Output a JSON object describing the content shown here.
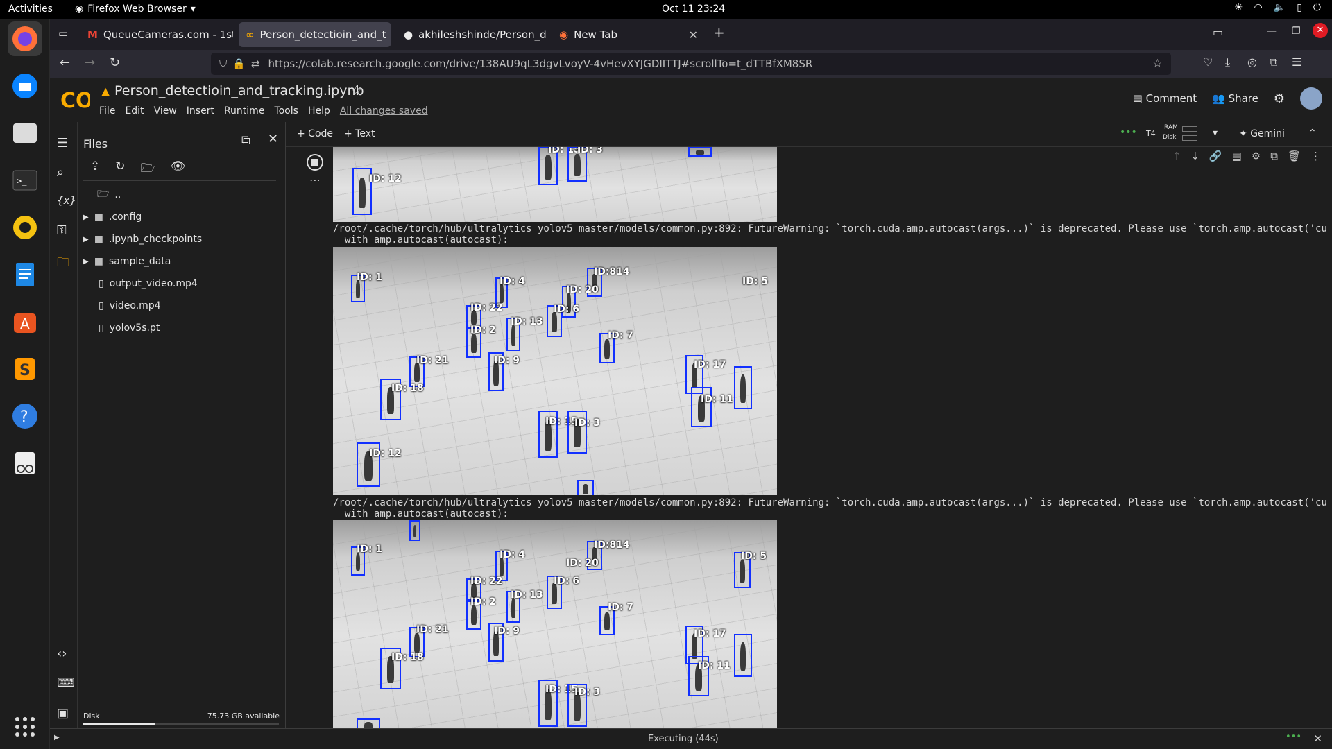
{
  "system": {
    "activities": "Activities",
    "app_name": "Firefox Web Browser",
    "clock": "Oct 11  23:24"
  },
  "dock": {
    "icons": [
      "firefox-icon",
      "thunderbird-icon",
      "files-icon",
      "terminal-icon",
      "rhythmbox-icon",
      "writer-icon",
      "app-center-icon",
      "sublime-icon",
      "help-icon",
      "reader-icon",
      "app-grid-icon"
    ]
  },
  "browser": {
    "tabs": [
      {
        "title": "QueueCameras.com - 1st"
      },
      {
        "title": "Person_detectioin_and_t"
      },
      {
        "title": "akhileshshinde/Person_d"
      },
      {
        "title": "New Tab"
      }
    ],
    "url": "https://colab.research.google.com/drive/138AU9qL3dgvLvoyV-4vHevXYJGDIITTJ#scrollTo=t_dTTBfXM8SR"
  },
  "colab": {
    "logo": "CO",
    "notebook_title": "Person_detectioin_and_tracking.ipynb",
    "menu": [
      "File",
      "Edit",
      "View",
      "Insert",
      "Runtime",
      "Tools",
      "Help"
    ],
    "saved": "All changes saved",
    "comment": "Comment",
    "share": "Share",
    "add_code": "+ Code",
    "add_text": "+ Text",
    "runtime": "T4",
    "ram": "RAM",
    "disk": "Disk",
    "gemini": "Gemini"
  },
  "files_panel": {
    "title": "Files",
    "items": [
      {
        "name": "..",
        "type": "parent"
      },
      {
        "name": ".config",
        "type": "folder"
      },
      {
        "name": ".ipynb_checkpoints",
        "type": "folder"
      },
      {
        "name": "sample_data",
        "type": "folder"
      },
      {
        "name": "output_video.mp4",
        "type": "file"
      },
      {
        "name": "video.mp4",
        "type": "file"
      },
      {
        "name": "yolov5s.pt",
        "type": "file"
      }
    ],
    "disk_label": "Disk",
    "disk_available": "75.73 GB available",
    "disk_used_fraction": 0.37
  },
  "output": {
    "warning_line1": "/root/.cache/torch/hub/ultralytics_yolov5_master/models/common.py:892: FutureWarning: `torch.cuda.amp.autocast(args...)` is deprecated. Please use `torch.amp.autocast('cu",
    "warning_line2": "  with amp.autocast(autocast):",
    "frame_top_labels": [
      "ID: 12",
      "ID: 15",
      "ID: 3"
    ],
    "frame_labels": [
      "ID: 1",
      "ID: 4",
      "ID:814",
      "ID: 5",
      "ID: 20",
      "ID: 22",
      "ID: 6",
      "ID: 13",
      "ID: 2",
      "ID: 7",
      "ID: 9",
      "ID: 21",
      "ID: 17",
      "ID: 18",
      "ID: 11",
      "ID: 15",
      "ID: 3",
      "ID: 12",
      "ID: 1"
    ]
  },
  "status": {
    "text": "Executing (44s)"
  }
}
